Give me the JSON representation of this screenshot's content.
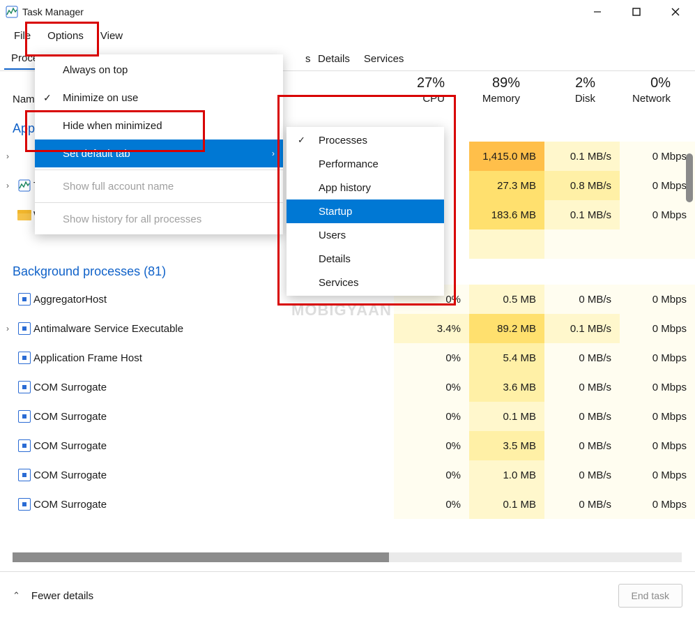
{
  "window": {
    "title": "Task Manager"
  },
  "menubar": {
    "file": "File",
    "options": "Options",
    "view": "View"
  },
  "tabs": {
    "processes": "Processes",
    "details": "Details",
    "services": "Services"
  },
  "headers": {
    "name": "Name",
    "cpu": {
      "pct": "27%",
      "label": "CPU"
    },
    "memory": {
      "pct": "89%",
      "label": "Memory"
    },
    "disk": {
      "pct": "2%",
      "label": "Disk"
    },
    "network": {
      "pct": "0%",
      "label": "Network"
    }
  },
  "sections": {
    "apps_title": "Apps",
    "bg_title": "Background processes (81)"
  },
  "apps": [
    {
      "name": "",
      "cpu": "",
      "mem": "1,415.0 MB",
      "disk": "0.1 MB/s",
      "net": "0 Mbps"
    },
    {
      "name": "Task Manager",
      "cpu": "",
      "mem": "27.3 MB",
      "disk": "0.8 MB/s",
      "net": "0 Mbps"
    },
    {
      "name": "Windows Explorer",
      "cpu": "",
      "mem": "183.6 MB",
      "disk": "0.1 MB/s",
      "net": "0 Mbps"
    }
  ],
  "bg": [
    {
      "name": "AggregatorHost",
      "cpu": "0%",
      "mem": "0.5 MB",
      "disk": "0 MB/s",
      "net": "0 Mbps"
    },
    {
      "name": "Antimalware Service Executable",
      "cpu": "3.4%",
      "mem": "89.2 MB",
      "disk": "0.1 MB/s",
      "net": "0 Mbps"
    },
    {
      "name": "Application Frame Host",
      "cpu": "0%",
      "mem": "5.4 MB",
      "disk": "0 MB/s",
      "net": "0 Mbps"
    },
    {
      "name": "COM Surrogate",
      "cpu": "0%",
      "mem": "3.6 MB",
      "disk": "0 MB/s",
      "net": "0 Mbps"
    },
    {
      "name": "COM Surrogate",
      "cpu": "0%",
      "mem": "0.1 MB",
      "disk": "0 MB/s",
      "net": "0 Mbps"
    },
    {
      "name": "COM Surrogate",
      "cpu": "0%",
      "mem": "3.5 MB",
      "disk": "0 MB/s",
      "net": "0 Mbps"
    },
    {
      "name": "COM Surrogate",
      "cpu": "0%",
      "mem": "1.0 MB",
      "disk": "0 MB/s",
      "net": "0 Mbps"
    },
    {
      "name": "COM Surrogate",
      "cpu": "0%",
      "mem": "0.1 MB",
      "disk": "0 MB/s",
      "net": "0 Mbps"
    }
  ],
  "options_menu": {
    "always_on_top": "Always on top",
    "minimize_on_use": "Minimize on use",
    "hide_when_minimized": "Hide when minimized",
    "set_default_tab": "Set default tab",
    "show_full_account_name": "Show full account name",
    "show_history": "Show history for all processes"
  },
  "submenu": {
    "processes": "Processes",
    "performance": "Performance",
    "app_history": "App history",
    "startup": "Startup",
    "users": "Users",
    "details": "Details",
    "services": "Services"
  },
  "footer": {
    "fewer_details": "Fewer details",
    "end_task": "End task"
  },
  "watermark": "MOBIGYAAN"
}
